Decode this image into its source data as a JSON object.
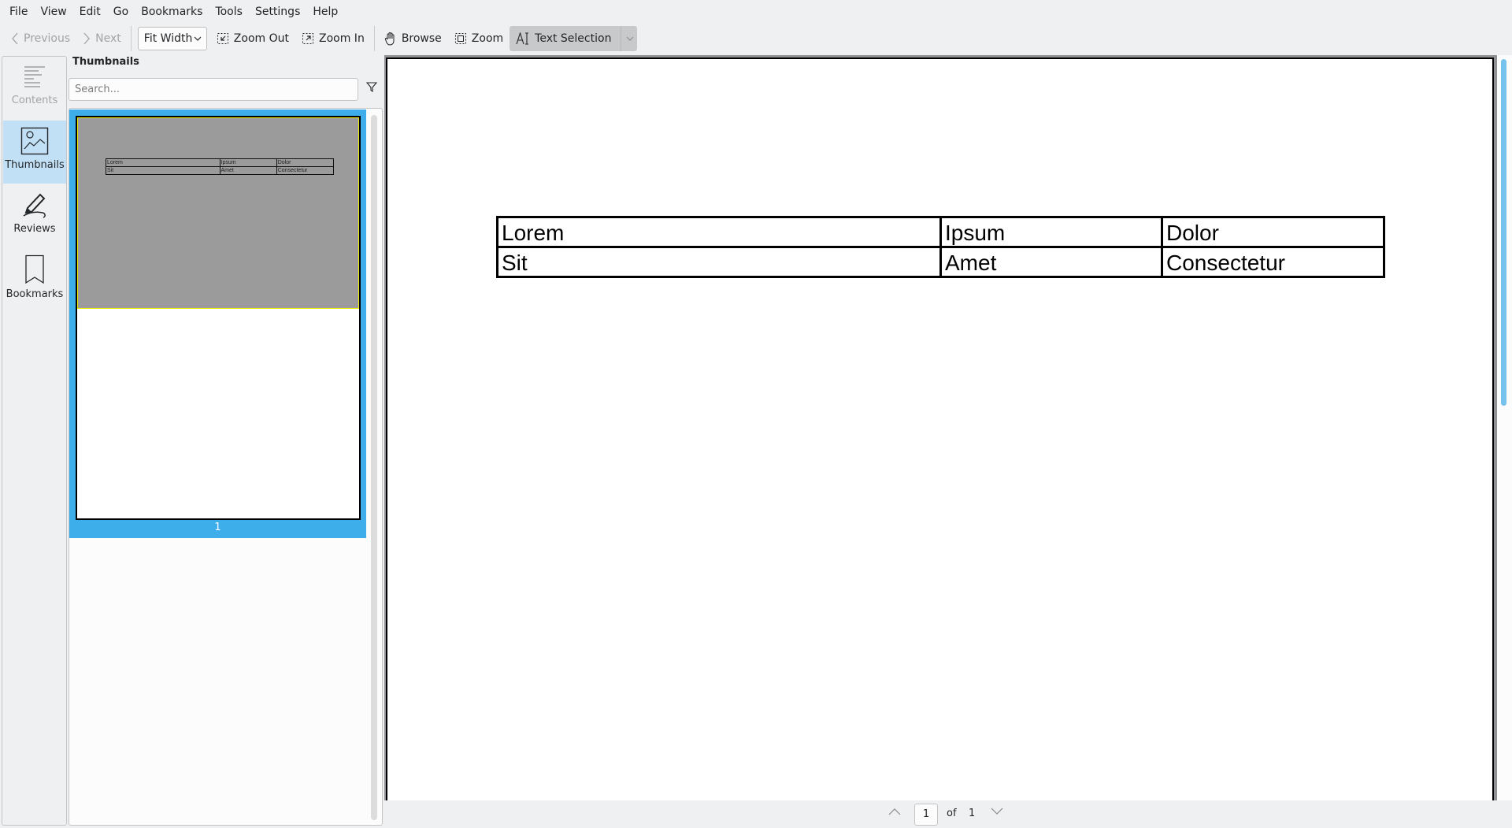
{
  "menu": [
    "File",
    "View",
    "Edit",
    "Go",
    "Bookmarks",
    "Tools",
    "Settings",
    "Help"
  ],
  "toolbar": {
    "previous": "Previous",
    "next": "Next",
    "zoom_mode": "Fit Width",
    "zoom_out": "Zoom Out",
    "zoom_in": "Zoom In",
    "browse": "Browse",
    "zoom": "Zoom",
    "text_selection": "Text Selection"
  },
  "sidebar": {
    "items": [
      {
        "label": "Contents",
        "icon": "contents-icon",
        "state": "disabled"
      },
      {
        "label": "Thumbnails",
        "icon": "thumbnails-icon",
        "state": "selected"
      },
      {
        "label": "Reviews",
        "icon": "reviews-icon",
        "state": "normal"
      },
      {
        "label": "Bookmarks",
        "icon": "bookmarks-icon",
        "state": "normal"
      }
    ]
  },
  "panel": {
    "title": "Thumbnails",
    "search_placeholder": "Search...",
    "thumbnails": [
      {
        "page": "1"
      }
    ]
  },
  "document": {
    "table": [
      [
        "Lorem",
        "Ipsum",
        "Dolor"
      ],
      [
        "Sit",
        "Amet",
        "Consectetur"
      ]
    ]
  },
  "pagebar": {
    "current": "1",
    "of_label": "of",
    "total": "1"
  },
  "colors": {
    "accent": "#3daee9",
    "selection_bg": "#c2e0f5",
    "thumb_highlight": "#9b9b9b",
    "scrollbar": "#75c2ee"
  }
}
